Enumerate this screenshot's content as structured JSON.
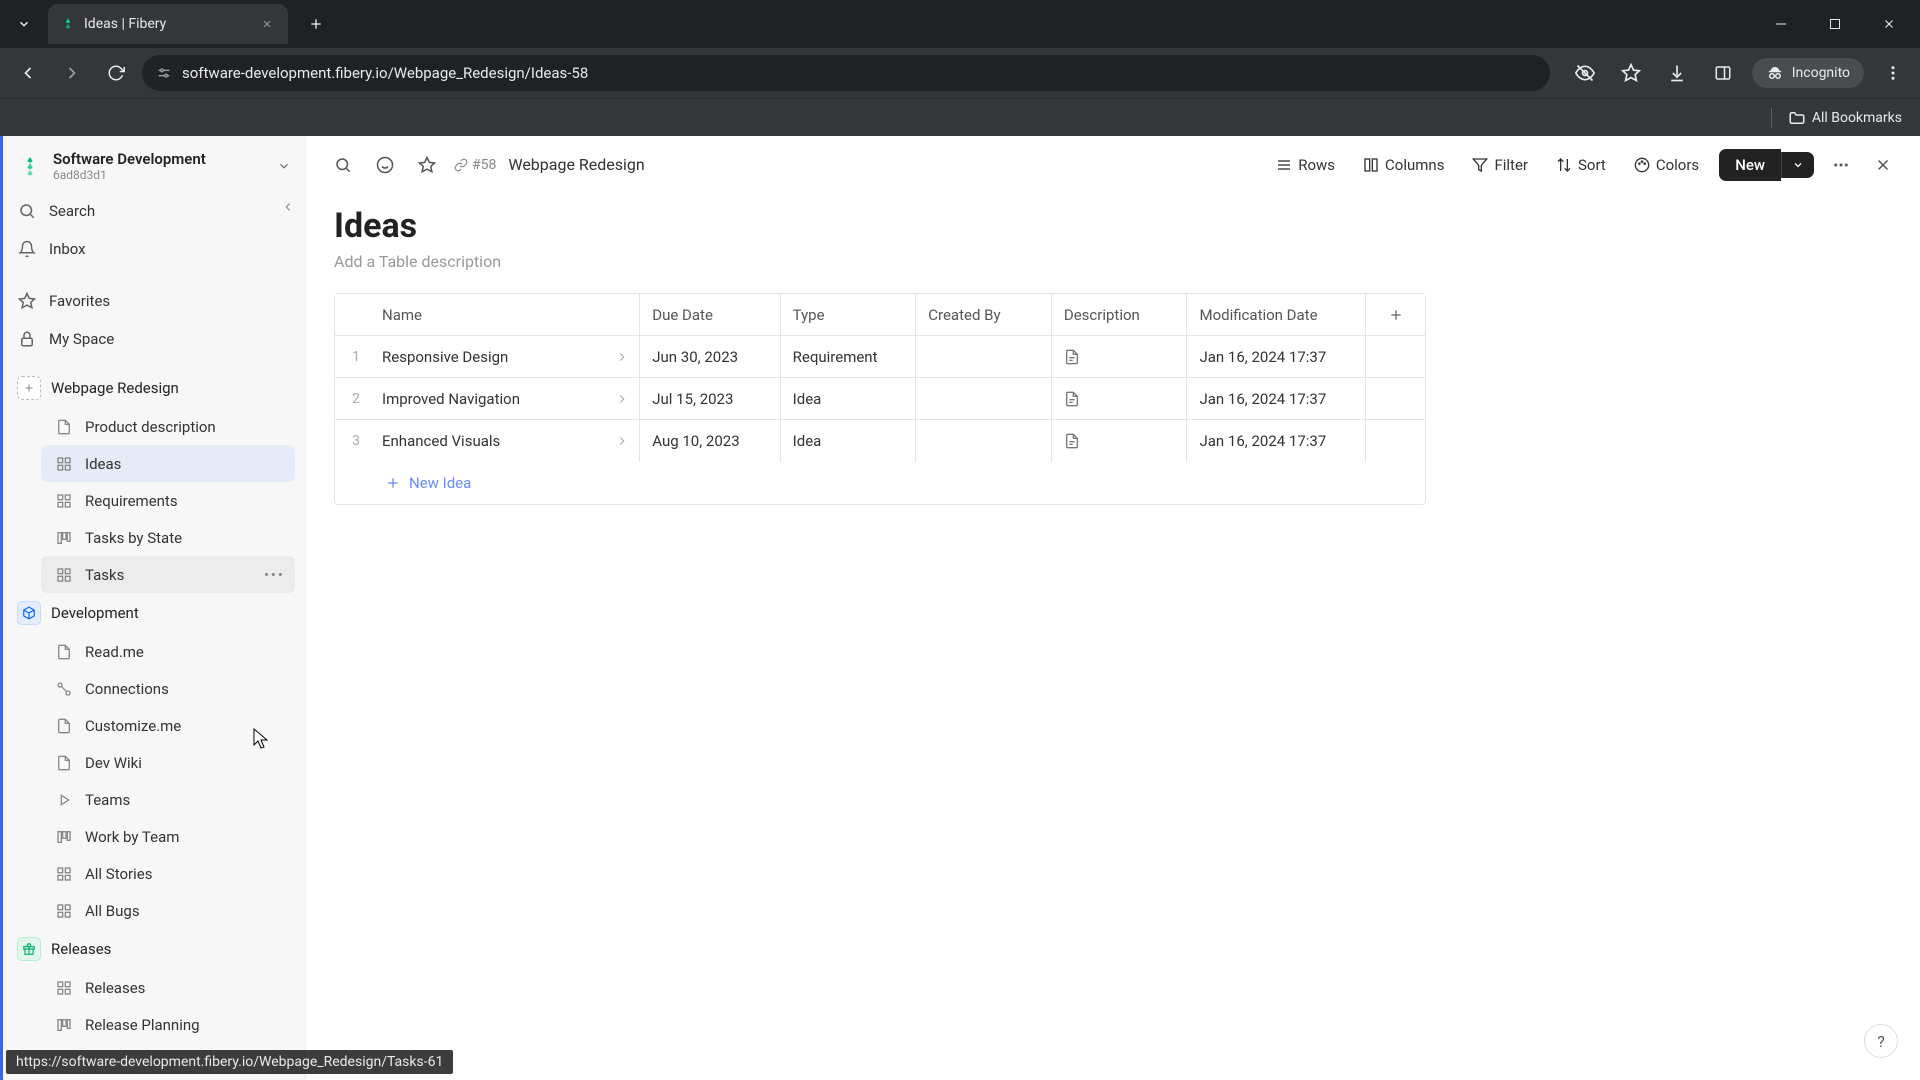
{
  "browser": {
    "tab_title": "Ideas | Fibery",
    "url": "software-development.fibery.io/Webpage_Redesign/Ideas-58",
    "incognito_label": "Incognito",
    "all_bookmarks": "All Bookmarks"
  },
  "workspace": {
    "name": "Software Development",
    "id": "6ad8d3d1",
    "search_label": "Search",
    "inbox_label": "Inbox",
    "favorites_label": "Favorites",
    "myspace_label": "My Space"
  },
  "sections": {
    "webpage": {
      "label": "Webpage Redesign",
      "items": [
        {
          "label": "Product description",
          "icon": "doc"
        },
        {
          "label": "Ideas",
          "icon": "grid",
          "active": true
        },
        {
          "label": "Requirements",
          "icon": "grid"
        },
        {
          "label": "Tasks by State",
          "icon": "board"
        },
        {
          "label": "Tasks",
          "icon": "grid",
          "hover": true
        }
      ]
    },
    "development": {
      "label": "Development",
      "items": [
        {
          "label": "Read.me",
          "icon": "doc"
        },
        {
          "label": "Connections",
          "icon": "connect"
        },
        {
          "label": "Customize.me",
          "icon": "doc"
        },
        {
          "label": "Dev Wiki",
          "icon": "doc"
        },
        {
          "label": "Teams",
          "icon": "play"
        },
        {
          "label": "Work by Team",
          "icon": "board"
        },
        {
          "label": "All Stories",
          "icon": "grid"
        },
        {
          "label": "All Bugs",
          "icon": "grid"
        }
      ]
    },
    "releases": {
      "label": "Releases",
      "items": [
        {
          "label": "Releases",
          "icon": "grid"
        },
        {
          "label": "Release Planning",
          "icon": "board"
        }
      ]
    }
  },
  "topbar": {
    "link_id": "#58",
    "breadcrumb": "Webpage Redesign",
    "rows": "Rows",
    "columns": "Columns",
    "filter": "Filter",
    "sort": "Sort",
    "colors": "Colors",
    "new": "New"
  },
  "page": {
    "title": "Ideas",
    "description_placeholder": "Add a Table description"
  },
  "table": {
    "headers": {
      "name": "Name",
      "due": "Due Date",
      "type": "Type",
      "creator": "Created By",
      "desc": "Description",
      "mod": "Modification Date"
    },
    "rows": [
      {
        "idx": "1",
        "name": "Responsive Design",
        "due": "Jun 30, 2023",
        "type": "Requirement",
        "creator": "",
        "mod": "Jan 16, 2024 17:37"
      },
      {
        "idx": "2",
        "name": "Improved Navigation",
        "due": "Jul 15, 2023",
        "type": "Idea",
        "creator": "",
        "mod": "Jan 16, 2024 17:37"
      },
      {
        "idx": "3",
        "name": "Enhanced Visuals",
        "due": "Aug 10, 2023",
        "type": "Idea",
        "creator": "",
        "mod": "Jan 16, 2024 17:37"
      }
    ],
    "new_row_label": "New Idea"
  },
  "status_url": "https://software-development.fibery.io/Webpage_Redesign/Tasks-61"
}
